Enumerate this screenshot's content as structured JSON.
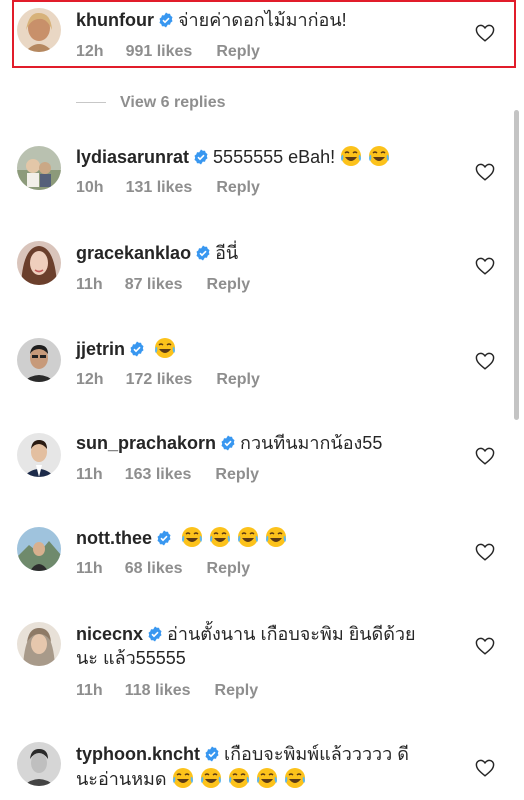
{
  "icons": {
    "verified": "verified-badge-icon",
    "heart": "heart-icon",
    "emoji": "face-with-tears-of-joy-icon"
  },
  "colors": {
    "verified_blue": "#3897f0",
    "highlight_red": "#e11c2a",
    "meta_gray": "#8e8e8e"
  },
  "view_replies": "View 6 replies",
  "comments": [
    {
      "username": "khunfour",
      "text": "จ่ายค่าดอกไม้มาก่อน!",
      "emoji_count": 0,
      "time": "12h",
      "likes": "991 likes",
      "reply": "Reply"
    },
    {
      "username": "lydiasarunrat",
      "text": "5555555 eBah!",
      "emoji_count": 2,
      "time": "10h",
      "likes": "131 likes",
      "reply": "Reply"
    },
    {
      "username": "gracekanklao",
      "text": "อีนี่",
      "emoji_count": 0,
      "time": "11h",
      "likes": "87 likes",
      "reply": "Reply"
    },
    {
      "username": "jjetrin",
      "text": "",
      "emoji_count": 1,
      "time": "12h",
      "likes": "172 likes",
      "reply": "Reply"
    },
    {
      "username": "sun_prachakorn",
      "text": "กวนทีนมากน้อง55",
      "emoji_count": 0,
      "time": "11h",
      "likes": "163 likes",
      "reply": "Reply"
    },
    {
      "username": "nott.thee",
      "text": "",
      "emoji_count": 4,
      "time": "11h",
      "likes": "68 likes",
      "reply": "Reply"
    },
    {
      "username": "nicecnx",
      "text": "อ่านตั้งนาน เกือบจะพิม ยินดีด้วย",
      "text2": "นะ แล้ว55555",
      "emoji_count": 0,
      "time": "11h",
      "likes": "118 likes",
      "reply": "Reply"
    },
    {
      "username": "typhoon.kncht",
      "text": "เกือบจะพิมพ์แล้ววววว ดี",
      "text2": "นะอ่านหมด",
      "emoji_count": 5,
      "time": "",
      "likes": "",
      "reply": ""
    }
  ]
}
